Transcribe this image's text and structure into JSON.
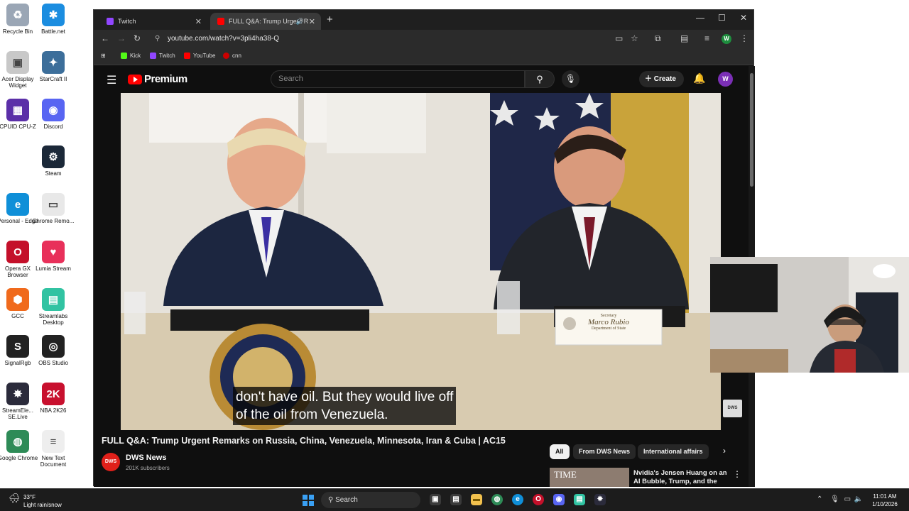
{
  "desktop": {
    "icons": [
      {
        "label": "Recycle Bin",
        "color": "#9aa6b5",
        "glyph": "♻"
      },
      {
        "label": "Battle.net",
        "color": "#1b8de0",
        "glyph": "✱"
      },
      {
        "label": "Acer Display Widget",
        "color": "#c8c8c8",
        "glyph": "▣"
      },
      {
        "label": "StarCraft II",
        "color": "#3c6e9a",
        "glyph": "✦"
      },
      {
        "label": "CPUID CPU-Z",
        "color": "#5b2fa8",
        "glyph": "▦"
      },
      {
        "label": "Discord",
        "color": "#5865f2",
        "glyph": "◉"
      },
      {
        "label": "Steam",
        "color": "#1b2838",
        "glyph": "⚙"
      },
      {
        "label": "Personal - Edge",
        "color": "#0f8fd8",
        "glyph": "e"
      },
      {
        "label": "Chrome Remo...",
        "color": "#e8e8e8",
        "glyph": "▭"
      },
      {
        "label": "Opera GX Browser",
        "color": "#c4102a",
        "glyph": "O"
      },
      {
        "label": "Lumia Stream",
        "color": "#e8305a",
        "glyph": "♥"
      },
      {
        "label": "GCC",
        "color": "#f06a1c",
        "glyph": "⬢"
      },
      {
        "label": "Streamlabs Desktop",
        "color": "#31c3a2",
        "glyph": "▤"
      },
      {
        "label": "SignalRgb",
        "color": "#222222",
        "glyph": "S"
      },
      {
        "label": "OBS Studio",
        "color": "#222222",
        "glyph": "◎"
      },
      {
        "label": "StreamEle... SE.Live",
        "color": "#2b2b3b",
        "glyph": "✸"
      },
      {
        "label": "NBA 2K26",
        "color": "#c8102e",
        "glyph": "2K"
      },
      {
        "label": "Google Chrome",
        "color": "#2e8b57",
        "glyph": "◍"
      },
      {
        "label": "New Text Document",
        "color": "#eeeeee",
        "glyph": "≡"
      }
    ]
  },
  "browser": {
    "tabs": [
      {
        "label": "Twitch",
        "color": "#9146ff",
        "active": false
      },
      {
        "label": "FULL Q&A: Trump Urgent R",
        "color": "#ff0000",
        "active": true
      }
    ],
    "url": "youtube.com/watch?v=3pli4ha38-Q",
    "profile_initial": "W",
    "bookmarks": [
      {
        "label": "Kick",
        "color": "#53fc18"
      },
      {
        "label": "Twitch",
        "color": "#9146ff"
      },
      {
        "label": "YouTube",
        "color": "#ff0000"
      },
      {
        "label": "cnn",
        "color": "#cc0000"
      }
    ]
  },
  "youtube": {
    "logo_text": "Premium",
    "search_placeholder": "Search",
    "create_label": "Create",
    "avatar_initial": "W",
    "caption_line1": "don't have oil. But they would live off",
    "caption_line2": "of the oil from Venezuela.",
    "nameplate_title": "Secretary",
    "nameplate_name": "Marco Rubio",
    "nameplate_dept": "Department of State",
    "dws_badge": "DWS",
    "video_title": "FULL Q&A: Trump Urgent Remarks on Russia, China, Venezuela, Minnesota, Iran & Cuba | AC15",
    "channel_logo": "DWS",
    "channel_name": "DWS News",
    "subscribers": "201K subscribers",
    "chips": [
      "All",
      "From DWS News",
      "International affairs"
    ],
    "recommendation": {
      "thumb_text": "TIME",
      "title": "Nvidia's Jensen Huang on an AI Bubble, Trump, and the Arms"
    }
  },
  "taskbar": {
    "temperature": "33°F",
    "weather": "Light rain/snow",
    "search_label": "Search",
    "time": "11:01 AM",
    "date": "1/10/2026"
  }
}
